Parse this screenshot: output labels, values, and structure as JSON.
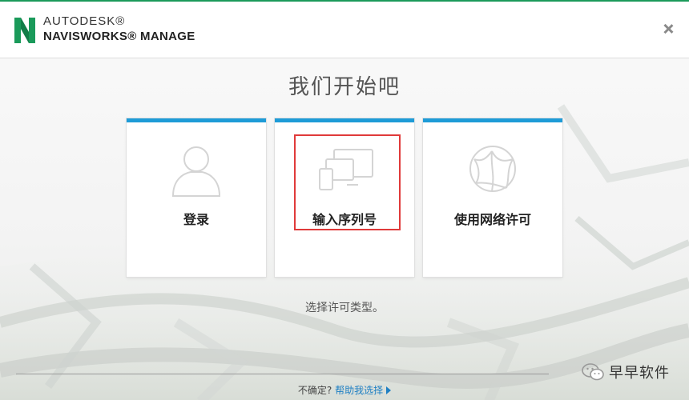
{
  "header": {
    "brand_top": "AUTODESK®",
    "brand_product": "NAVISWORKS® MANAGE",
    "colors": {
      "logo_green": "#1a9a5a",
      "accent_blue": "#1e9bd7"
    }
  },
  "main": {
    "title": "我们开始吧",
    "cards": [
      {
        "label": "登录",
        "icon": "user-icon"
      },
      {
        "label": "输入序列号",
        "icon": "devices-icon"
      },
      {
        "label": "使用网络许可",
        "icon": "network-globe-icon"
      }
    ],
    "subtitle": "选择许可类型。"
  },
  "footer": {
    "question": "不确定?",
    "help_link": "帮助我选择"
  },
  "watermark": {
    "text": "早早软件"
  }
}
